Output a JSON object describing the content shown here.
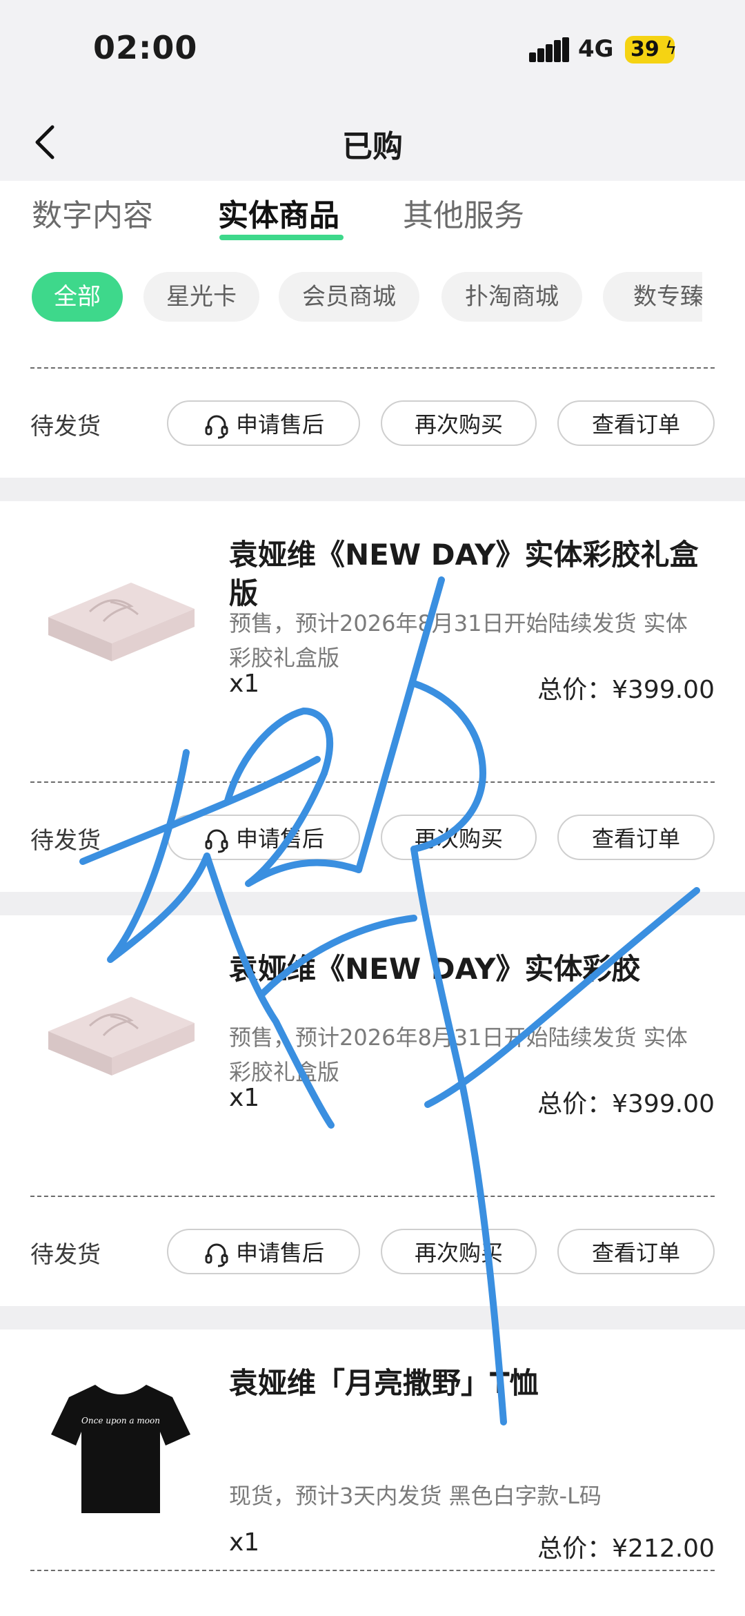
{
  "status": {
    "time": "02:00",
    "network": "4G",
    "battery": "39"
  },
  "nav": {
    "title": "已购"
  },
  "tabs": [
    {
      "label": "数字内容"
    },
    {
      "label": "实体商品"
    },
    {
      "label": "其他服务"
    }
  ],
  "filters": [
    {
      "label": "全部"
    },
    {
      "label": "星光卡"
    },
    {
      "label": "会员商城"
    },
    {
      "label": "扑淘商城"
    },
    {
      "label": "数专臻"
    }
  ],
  "orders": [
    {
      "status": "待发货",
      "actions": {
        "after_sale": "申请售后",
        "rebuy": "再次购买",
        "view": "查看订单"
      }
    },
    {
      "title": "袁娅维《NEW DAY》实体彩胶礼盒版",
      "desc": "预售，预计2026年8月31日开始陆续发货 实体彩胶礼盒版",
      "qty": "x1",
      "price": "总价：¥399.00",
      "status": "待发货",
      "actions": {
        "after_sale": "申请售后",
        "rebuy": "再次购买",
        "view": "查看订单"
      }
    },
    {
      "title": "袁娅维《NEW DAY》实体彩胶",
      "desc": "预售，预计2026年8月31日开始陆续发货 实体彩胶礼盒版",
      "qty": "x1",
      "price": "总价：¥399.00",
      "status": "待发货",
      "actions": {
        "after_sale": "申请售后",
        "rebuy": "再次购买",
        "view": "查看订单"
      }
    },
    {
      "title": "袁娅维「月亮撒野」T恤",
      "desc": "现货，预计3天内发货 黑色白字款-L码",
      "qty": "x1",
      "price": "总价：¥212.00",
      "tee_print": "Once upon a moon"
    }
  ],
  "colors": {
    "accent": "#3ed88b",
    "scribble": "#3a8fe0",
    "battery": "#f5d313"
  }
}
